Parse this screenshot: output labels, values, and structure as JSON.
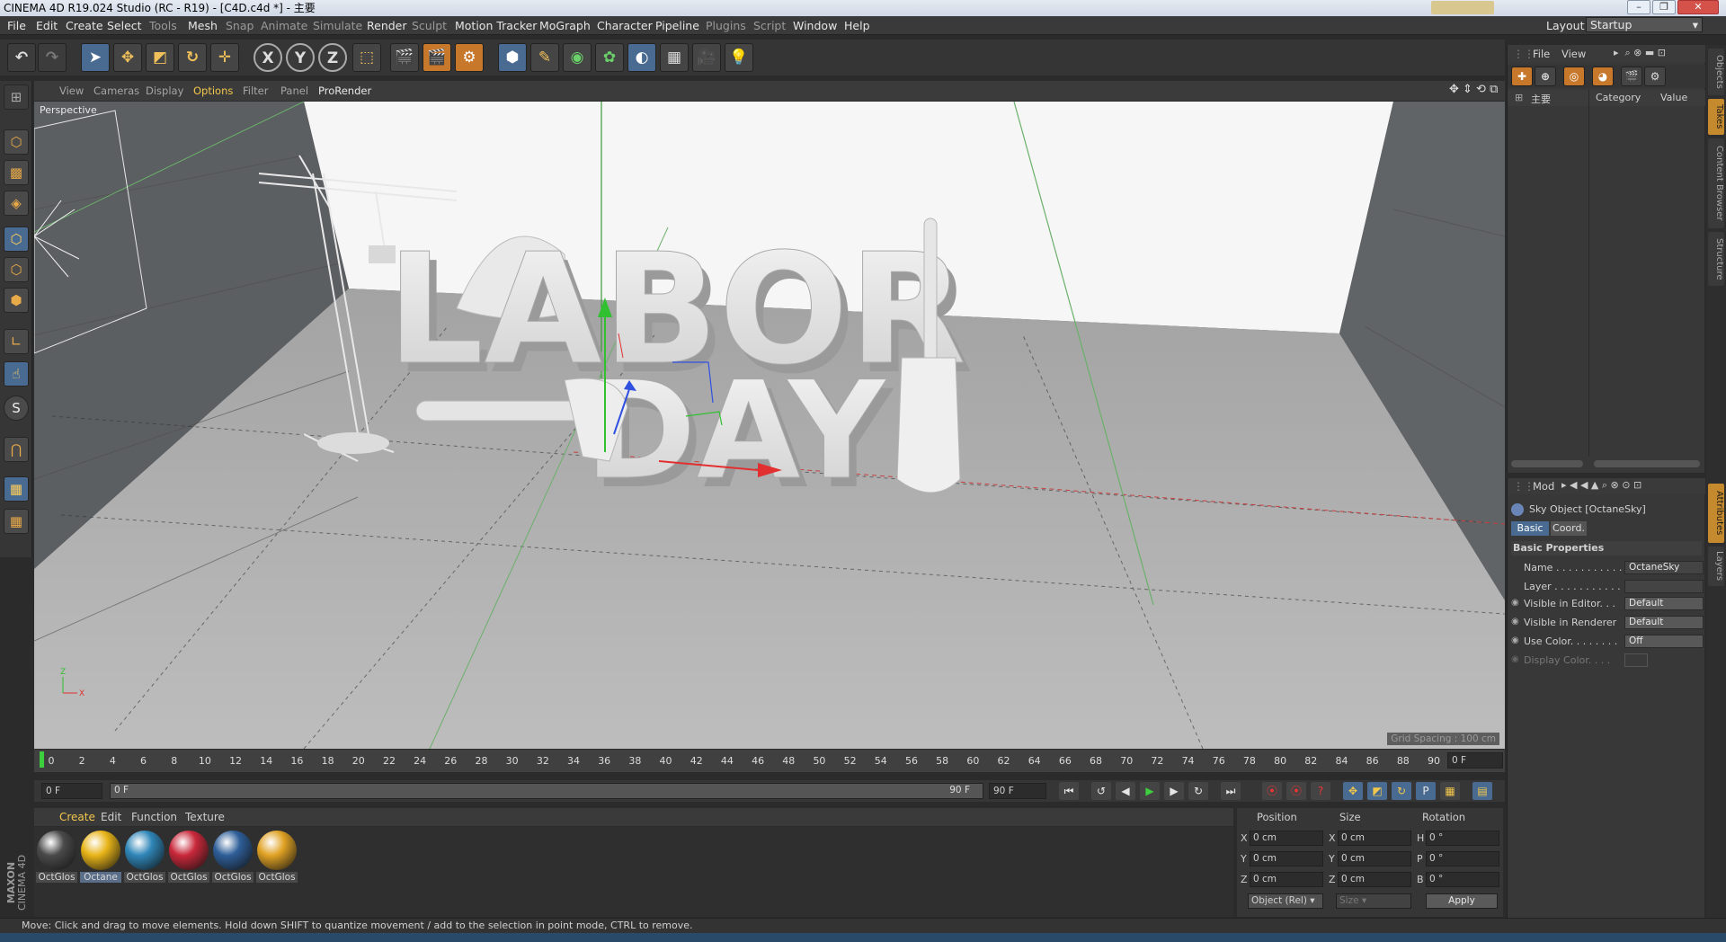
{
  "window": {
    "title": "CINEMA 4D R19.024 Studio (RC - R19) - [C4D.c4d *] - 主要",
    "layout_label": "Layout:",
    "layout_value": "Startup"
  },
  "menubar": {
    "items": [
      "File",
      "Edit",
      "Create",
      "Select",
      "Tools",
      "Mesh",
      "Snap",
      "Animate",
      "Simulate",
      "Render",
      "Sculpt",
      "Motion Tracker",
      "MoGraph",
      "Character",
      "Pipeline",
      "Plugins",
      "Script",
      "Window",
      "Help"
    ]
  },
  "toolbar": {
    "axis_x": "X",
    "axis_y": "Y",
    "axis_z": "Z"
  },
  "viewport": {
    "menu": [
      "View",
      "Cameras",
      "Display",
      "Options",
      "Filter",
      "Panel",
      "ProRender"
    ],
    "label": "Perspective",
    "grid_spacing": "Grid Spacing : 100 cm",
    "scene_text_line1": "LABOR",
    "scene_text_line2": "DAY"
  },
  "timeline": {
    "ticks": [
      "0",
      "2",
      "4",
      "6",
      "8",
      "10",
      "12",
      "14",
      "16",
      "18",
      "20",
      "22",
      "24",
      "26",
      "28",
      "30",
      "32",
      "34",
      "36",
      "38",
      "40",
      "42",
      "44",
      "46",
      "48",
      "50",
      "52",
      "54",
      "56",
      "58",
      "60",
      "62",
      "64",
      "66",
      "68",
      "70",
      "72",
      "74",
      "76",
      "78",
      "80",
      "82",
      "84",
      "86",
      "88",
      "90"
    ],
    "current_frame": "0 F",
    "start_frame": "0 F",
    "range_start": "0 F",
    "range_end": "90 F",
    "end_frame": "90 F"
  },
  "materials": {
    "menu": [
      "Create",
      "Edit",
      "Function",
      "Texture"
    ],
    "items": [
      {
        "label": "OctGlos",
        "color": "#4a4a4a"
      },
      {
        "label": "Octane",
        "color": "#e8b418"
      },
      {
        "label": "OctGlos",
        "color": "#2f86b8"
      },
      {
        "label": "OctGlos",
        "color": "#c8283a"
      },
      {
        "label": "OctGlos",
        "color": "#2e5e98"
      },
      {
        "label": "OctGlos",
        "color": "#e0a224"
      }
    ]
  },
  "coordinates": {
    "headers": {
      "position": "Position",
      "size": "Size",
      "rotation": "Rotation"
    },
    "rows": [
      {
        "axis": "X",
        "pos": "0 cm",
        "size_axis": "X",
        "size": "0 cm",
        "rot_axis": "H",
        "rot": "0 °"
      },
      {
        "axis": "Y",
        "pos": "0 cm",
        "size_axis": "Y",
        "size": "0 cm",
        "rot_axis": "P",
        "rot": "0 °"
      },
      {
        "axis": "Z",
        "pos": "0 cm",
        "size_axis": "Z",
        "size": "0 cm",
        "rot_axis": "B",
        "rot": "0 °"
      }
    ],
    "mode_dropdown": "Object (Rel)",
    "size_dropdown": "Size",
    "apply_label": "Apply"
  },
  "objects_panel": {
    "menu": [
      "File",
      "View"
    ],
    "columns": {
      "name": "主要",
      "category": "Category",
      "value": "Value"
    }
  },
  "attributes": {
    "menu": [
      "Mod"
    ],
    "object_title": "Sky Object [OctaneSky]",
    "tabs": [
      "Basic",
      "Coord."
    ],
    "section": "Basic Properties",
    "rows": [
      {
        "label": "Name . . . . . . . . . . .",
        "value": "OctaneSky"
      },
      {
        "label": "Layer . . . . . . . . . . .",
        "value": ""
      },
      {
        "label": "Visible in Editor. . .",
        "value": "Default"
      },
      {
        "label": "Visible in Renderer",
        "value": "Default"
      },
      {
        "label": "Use Color. . . . . . . .",
        "value": "Off"
      },
      {
        "label": "Display Color. . . .",
        "value": ""
      }
    ]
  },
  "side_tabs": [
    "Objects",
    "Takes",
    "Content Browser",
    "Structure",
    "Attributes",
    "Layers"
  ],
  "status": {
    "text": "Move: Click and drag to move elements. Hold down SHIFT to quantize movement / add to the selection in point mode, CTRL to remove."
  },
  "brand": {
    "line1": "MAXON",
    "line2": "CINEMA 4D"
  },
  "colors": {
    "accent": "#f2c74c",
    "active_blue": "#4a6b91",
    "axis_x": "#e23030",
    "axis_y": "#30c030",
    "axis_z": "#3050e0"
  }
}
